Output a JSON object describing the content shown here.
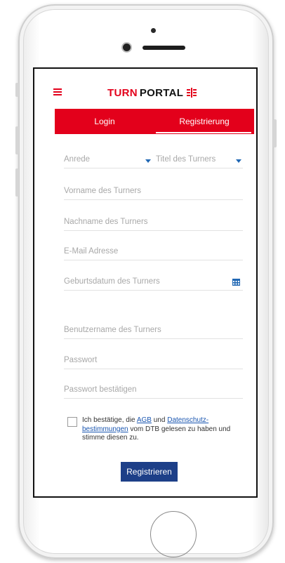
{
  "header": {
    "logo_part1": "TURN",
    "logo_part2": "PORTAL",
    "accent": "#e3001b"
  },
  "tabs": [
    {
      "label": "Login",
      "active": false
    },
    {
      "label": "Registrierung",
      "active": true
    }
  ],
  "form": {
    "anrede_placeholder": "Anrede",
    "titel_placeholder": "Titel des Turners",
    "vorname_placeholder": "Vorname des Turners",
    "nachname_placeholder": "Nachname des Turners",
    "email_placeholder": "E-Mail Adresse",
    "geburtsdatum_placeholder": "Geburtsdatum des Turners",
    "benutzername_placeholder": "Benutzername des Turners",
    "passwort_placeholder": "Passwort",
    "passwort_bestaetigen_placeholder": "Passwort bestätigen"
  },
  "consent": {
    "text_before": "Ich bestätige, die ",
    "agb_link": "AGB",
    "text_middle": " und ",
    "privacy_link": "Datenschutz-bestimmungen",
    "text_after": " vom DTB gelesen zu haben und stimme diesen zu.",
    "checked": false
  },
  "submit_label": "Registrieren",
  "colors": {
    "primary_red": "#e3001b",
    "button_blue": "#1d3f88",
    "link_blue": "#1a56b0"
  },
  "icons": [
    "menu-icon",
    "calendar-icon",
    "chevron-down-icon",
    "dtb-logo-icon"
  ]
}
